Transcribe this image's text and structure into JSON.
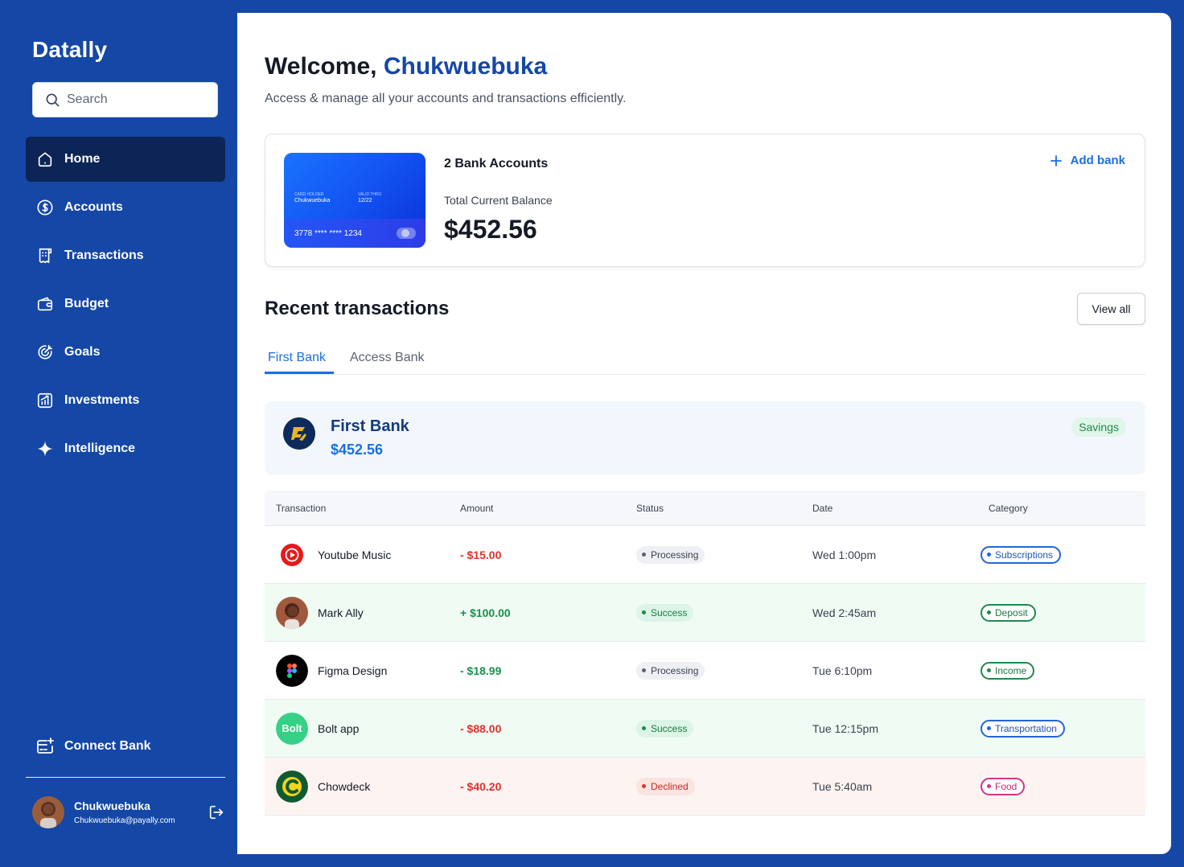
{
  "app": {
    "name": "Datally"
  },
  "search": {
    "placeholder": "Search"
  },
  "sidebar": {
    "items": [
      {
        "label": "Home",
        "icon": "home-icon",
        "active": true
      },
      {
        "label": "Accounts",
        "icon": "dollar-circle-icon"
      },
      {
        "label": "Transactions",
        "icon": "receipt-icon"
      },
      {
        "label": "Budget",
        "icon": "wallet-icon"
      },
      {
        "label": "Goals",
        "icon": "target-icon"
      },
      {
        "label": "Investments",
        "icon": "chart-icon"
      },
      {
        "label": "Intelligence",
        "icon": "sparkle-icon"
      }
    ],
    "connect_label": "Connect Bank",
    "user": {
      "name": "Chukwuebuka",
      "email": "Chukwuebuka@payally.com"
    }
  },
  "header": {
    "welcome": "Welcome,",
    "username": "Chukwuebuka",
    "subtitle": "Access & manage all your accounts and transactions efficiently."
  },
  "summary": {
    "card": {
      "holder_label": "CARD HOLDER",
      "holder": "Chukwuebuka",
      "valid_label": "VALID THRU",
      "valid": "12/22",
      "number": "3778 **** **** 1234"
    },
    "accounts_count": "2 Bank Accounts",
    "balance_label": "Total Current Balance",
    "balance": "$452.56",
    "add_bank_label": "Add bank"
  },
  "recent": {
    "title": "Recent transactions",
    "view_all": "View all",
    "tabs": [
      "First Bank",
      "Access Bank"
    ],
    "bank": {
      "name": "First Bank",
      "balance": "$452.56",
      "type": "Savings"
    },
    "columns": [
      "Transaction",
      "Amount",
      "Status",
      "Date",
      "Category"
    ],
    "rows": [
      {
        "name": "Youtube Music",
        "amount": "- $15.00",
        "status": "Processing",
        "date": "Wed 1:00pm",
        "category": "Subscriptions"
      },
      {
        "name": "Mark Ally",
        "amount": "+ $100.00",
        "status": "Success",
        "date": "Wed 2:45am",
        "category": "Deposit"
      },
      {
        "name": "Figma Design",
        "amount": "- $18.99",
        "status": "Processing",
        "date": "Tue 6:10pm",
        "category": "Income"
      },
      {
        "name": "Bolt app",
        "amount": "- $88.00",
        "status": "Success",
        "date": "Tue 12:15pm",
        "category": "Transportation"
      },
      {
        "name": "Chowdeck",
        "amount": "- $40.20",
        "status": "Declined",
        "date": "Tue 5:40am",
        "category": "Food"
      }
    ]
  },
  "colors": {
    "brand": "#1447a6",
    "sidebar_active": "#0c2456",
    "accent": "#1b6fe0"
  }
}
